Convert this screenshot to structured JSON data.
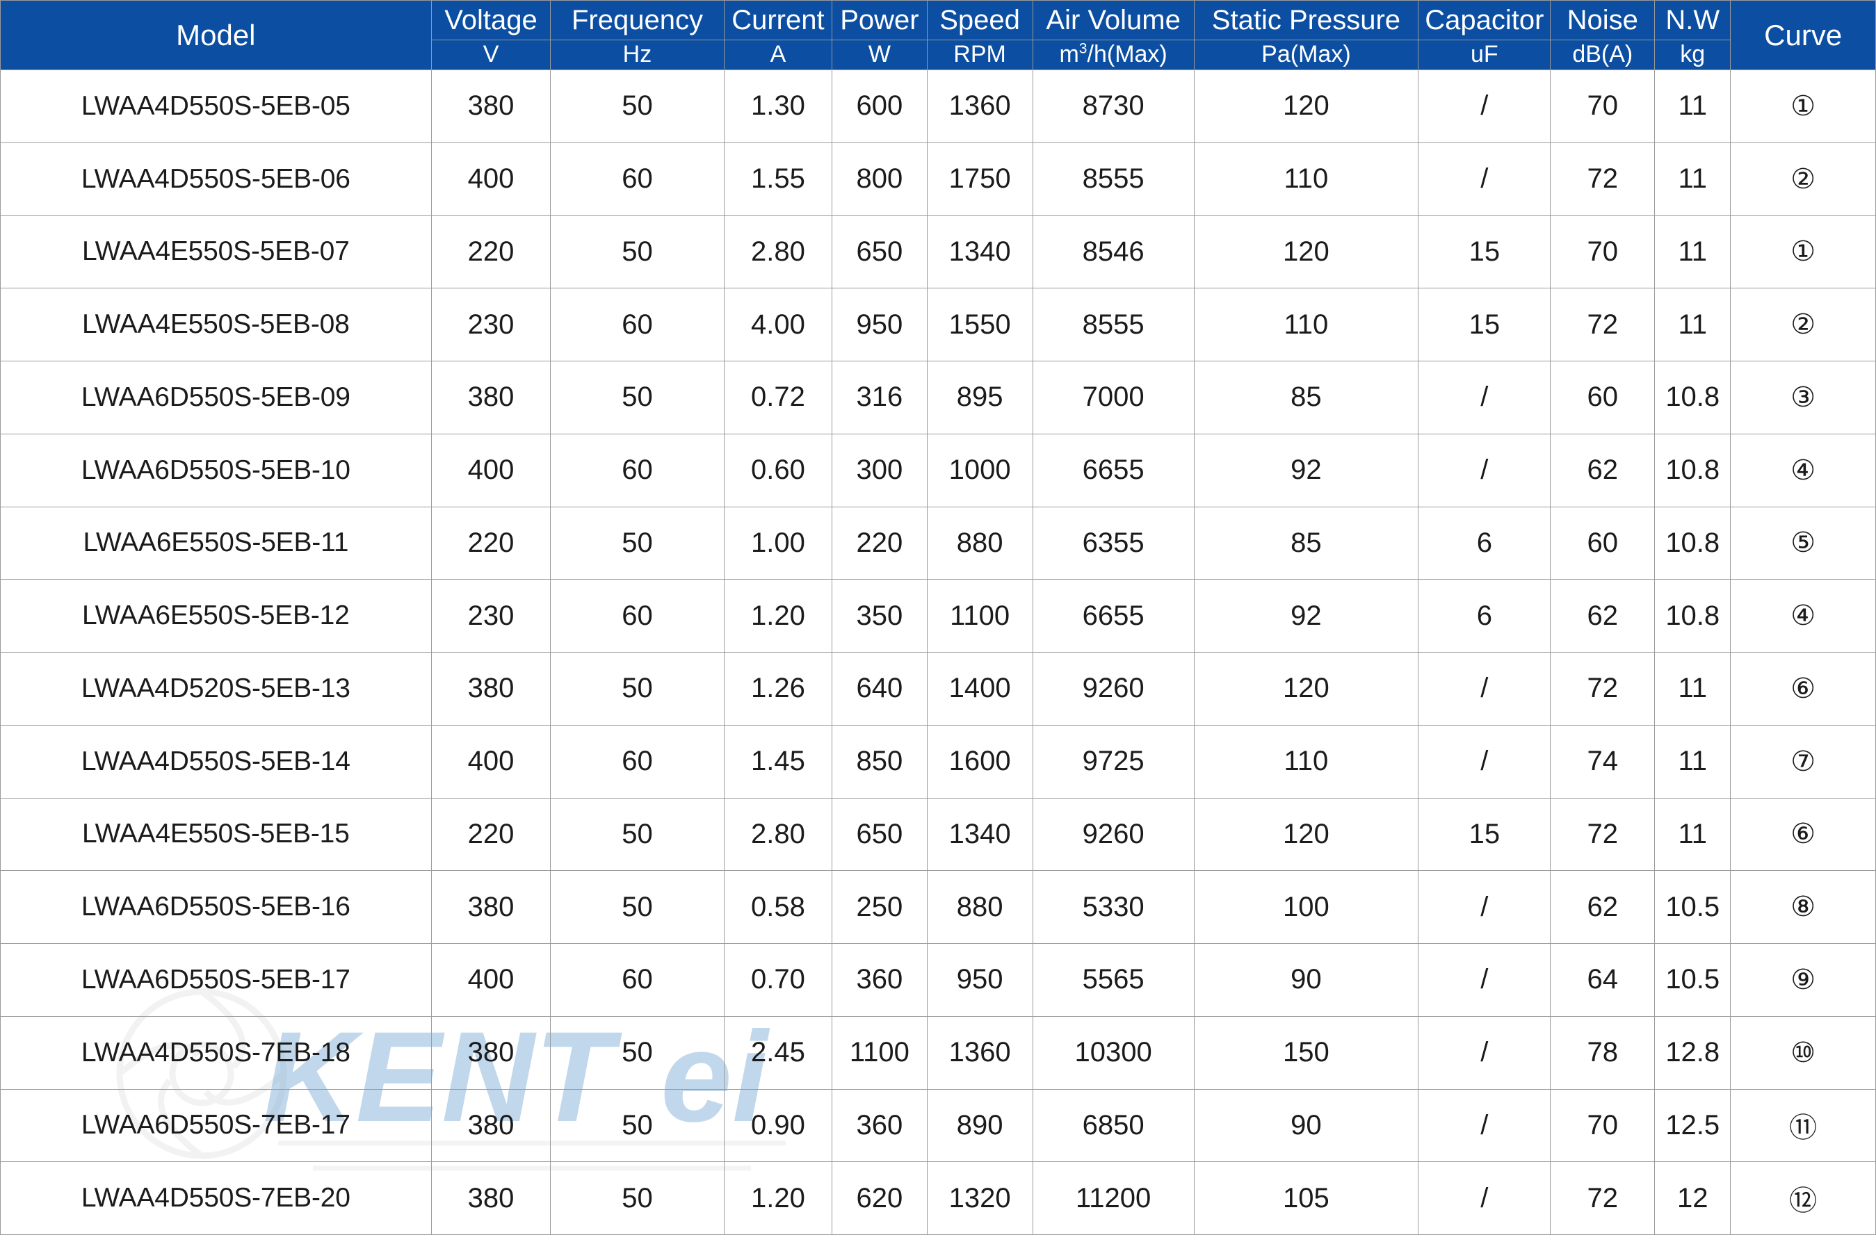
{
  "table": {
    "header_groups": [
      {
        "label": "Model",
        "unit": null,
        "merged": true
      },
      {
        "label": "Voltage",
        "unit": "V",
        "merged": false
      },
      {
        "label": "Frequency",
        "unit": "Hz",
        "merged": false
      },
      {
        "label": "Current",
        "unit": "A",
        "merged": false
      },
      {
        "label": "Power",
        "unit": "W",
        "merged": false
      },
      {
        "label": "Speed",
        "unit": "RPM",
        "merged": false
      },
      {
        "label": "Air Volume",
        "unit": "m³/h(Max)",
        "merged": false
      },
      {
        "label": "Static Pressure",
        "unit": "Pa(Max)",
        "merged": false
      },
      {
        "label": "Capacitor",
        "unit": "uF",
        "merged": false
      },
      {
        "label": "Noise",
        "unit": "dB(A)",
        "merged": false
      },
      {
        "label": "N.W",
        "unit": "kg",
        "merged": false
      },
      {
        "label": "Curve",
        "unit": null,
        "merged": true
      }
    ],
    "rows": [
      {
        "model": "LWAA4D550S-5EB-05",
        "voltage": "380",
        "frequency": "50",
        "current": "1.30",
        "power": "600",
        "speed": "1360",
        "air_volume": "8730",
        "static_pressure": "120",
        "capacitor": "/",
        "noise": "70",
        "nw": "11",
        "curve": "①"
      },
      {
        "model": "LWAA4D550S-5EB-06",
        "voltage": "400",
        "frequency": "60",
        "current": "1.55",
        "power": "800",
        "speed": "1750",
        "air_volume": "8555",
        "static_pressure": "110",
        "capacitor": "/",
        "noise": "72",
        "nw": "11",
        "curve": "②"
      },
      {
        "model": "LWAA4E550S-5EB-07",
        "voltage": "220",
        "frequency": "50",
        "current": "2.80",
        "power": "650",
        "speed": "1340",
        "air_volume": "8546",
        "static_pressure": "120",
        "capacitor": "15",
        "noise": "70",
        "nw": "11",
        "curve": "①"
      },
      {
        "model": "LWAA4E550S-5EB-08",
        "voltage": "230",
        "frequency": "60",
        "current": "4.00",
        "power": "950",
        "speed": "1550",
        "air_volume": "8555",
        "static_pressure": "110",
        "capacitor": "15",
        "noise": "72",
        "nw": "11",
        "curve": "②"
      },
      {
        "model": "LWAA6D550S-5EB-09",
        "voltage": "380",
        "frequency": "50",
        "current": "0.72",
        "power": "316",
        "speed": "895",
        "air_volume": "7000",
        "static_pressure": "85",
        "capacitor": "/",
        "noise": "60",
        "nw": "10.8",
        "curve": "③"
      },
      {
        "model": "LWAA6D550S-5EB-10",
        "voltage": "400",
        "frequency": "60",
        "current": "0.60",
        "power": "300",
        "speed": "1000",
        "air_volume": "6655",
        "static_pressure": "92",
        "capacitor": "/",
        "noise": "62",
        "nw": "10.8",
        "curve": "④"
      },
      {
        "model": "LWAA6E550S-5EB-11",
        "voltage": "220",
        "frequency": "50",
        "current": "1.00",
        "power": "220",
        "speed": "880",
        "air_volume": "6355",
        "static_pressure": "85",
        "capacitor": "6",
        "noise": "60",
        "nw": "10.8",
        "curve": "⑤"
      },
      {
        "model": "LWAA6E550S-5EB-12",
        "voltage": "230",
        "frequency": "60",
        "current": "1.20",
        "power": "350",
        "speed": "1100",
        "air_volume": "6655",
        "static_pressure": "92",
        "capacitor": "6",
        "noise": "62",
        "nw": "10.8",
        "curve": "④"
      },
      {
        "model": "LWAA4D520S-5EB-13",
        "voltage": "380",
        "frequency": "50",
        "current": "1.26",
        "power": "640",
        "speed": "1400",
        "air_volume": "9260",
        "static_pressure": "120",
        "capacitor": "/",
        "noise": "72",
        "nw": "11",
        "curve": "⑥"
      },
      {
        "model": "LWAA4D550S-5EB-14",
        "voltage": "400",
        "frequency": "60",
        "current": "1.45",
        "power": "850",
        "speed": "1600",
        "air_volume": "9725",
        "static_pressure": "110",
        "capacitor": "/",
        "noise": "74",
        "nw": "11",
        "curve": "⑦"
      },
      {
        "model": "LWAA4E550S-5EB-15",
        "voltage": "220",
        "frequency": "50",
        "current": "2.80",
        "power": "650",
        "speed": "1340",
        "air_volume": "9260",
        "static_pressure": "120",
        "capacitor": "15",
        "noise": "72",
        "nw": "11",
        "curve": "⑥"
      },
      {
        "model": "LWAA6D550S-5EB-16",
        "voltage": "380",
        "frequency": "50",
        "current": "0.58",
        "power": "250",
        "speed": "880",
        "air_volume": "5330",
        "static_pressure": "100",
        "capacitor": "/",
        "noise": "62",
        "nw": "10.5",
        "curve": "⑧"
      },
      {
        "model": "LWAA6D550S-5EB-17",
        "voltage": "400",
        "frequency": "60",
        "current": "0.70",
        "power": "360",
        "speed": "950",
        "air_volume": "5565",
        "static_pressure": "90",
        "capacitor": "/",
        "noise": "64",
        "nw": "10.5",
        "curve": "⑨"
      },
      {
        "model": "LWAA4D550S-7EB-18",
        "voltage": "380",
        "frequency": "50",
        "current": "2.45",
        "power": "1100",
        "speed": "1360",
        "air_volume": "10300",
        "static_pressure": "150",
        "capacitor": "/",
        "noise": "78",
        "nw": "12.8",
        "curve": "⑩"
      },
      {
        "model": "LWAA6D550S-7EB-17",
        "voltage": "380",
        "frequency": "50",
        "current": "0.90",
        "power": "360",
        "speed": "890",
        "air_volume": "6850",
        "static_pressure": "90",
        "capacitor": "/",
        "noise": "70",
        "nw": "12.5",
        "curve": "⑪"
      },
      {
        "model": "LWAA4D550S-7EB-20",
        "voltage": "380",
        "frequency": "50",
        "current": "1.20",
        "power": "620",
        "speed": "1320",
        "air_volume": "11200",
        "static_pressure": "105",
        "capacitor": "/",
        "noise": "72",
        "nw": "12",
        "curve": "⑫"
      }
    ]
  },
  "watermark": {
    "text": "KENTEI"
  },
  "colors": {
    "header_background": "#0b4ea2",
    "header_text": "#ffffff",
    "grid_line": "#9a9a9a",
    "body_text": "#1b1b1b",
    "watermark_blue": "#1f6fb8",
    "watermark_gray": "#c9c9c9"
  }
}
